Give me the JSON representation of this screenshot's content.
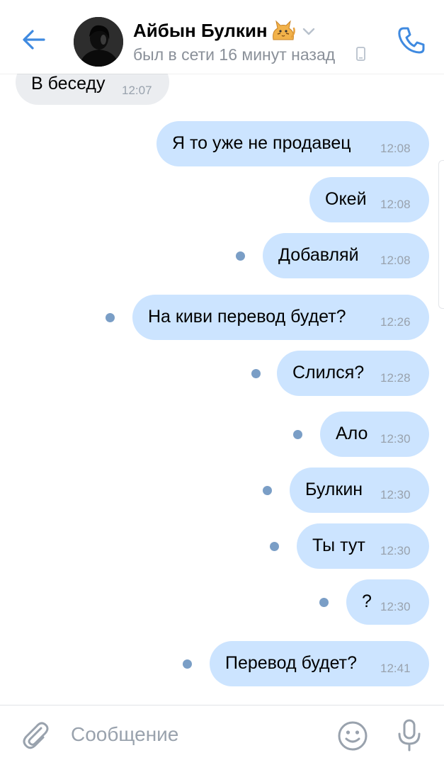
{
  "header": {
    "contact_name": "Айбын Булкин",
    "status": "был в сети 16 минут назад",
    "name_emoji": "cat-icon",
    "icons": [
      "back-arrow-icon",
      "chevron-down-icon",
      "mobile-phone-icon",
      "phone-call-icon"
    ]
  },
  "messages": [
    {
      "direction": "in",
      "text": "В беседу",
      "time": "12:07",
      "unread": false
    },
    {
      "direction": "out",
      "text": "Я то уже не продавец",
      "time": "12:08",
      "unread": false
    },
    {
      "direction": "out",
      "text": "Окей",
      "time": "12:08",
      "unread": false
    },
    {
      "direction": "out",
      "text": "Добавляй",
      "time": "12:08",
      "unread": true
    },
    {
      "direction": "out",
      "text": "На киви перевод будет?",
      "time": "12:26",
      "unread": true
    },
    {
      "direction": "out",
      "text": "Слился?",
      "time": "12:28",
      "unread": true
    },
    {
      "direction": "out",
      "text": "Ало",
      "time": "12:30",
      "unread": true
    },
    {
      "direction": "out",
      "text": "Булкин",
      "time": "12:30",
      "unread": true
    },
    {
      "direction": "out",
      "text": "Ты тут",
      "time": "12:30",
      "unread": true
    },
    {
      "direction": "out",
      "text": "?",
      "time": "12:30",
      "unread": true
    },
    {
      "direction": "out",
      "text": "Перевод будет?",
      "time": "12:41",
      "unread": true
    }
  ],
  "composer": {
    "placeholder": "Сообщение",
    "value": "",
    "icons": [
      "paperclip-icon",
      "emoji-smile-icon",
      "microphone-icon"
    ]
  },
  "colors": {
    "accent": "#3f8ae0",
    "incoming_bubble": "#ebedf0",
    "outgoing_bubble": "#cce4ff",
    "unread_dot": "#7a9ec6",
    "secondary_text": "#99a2ad"
  }
}
